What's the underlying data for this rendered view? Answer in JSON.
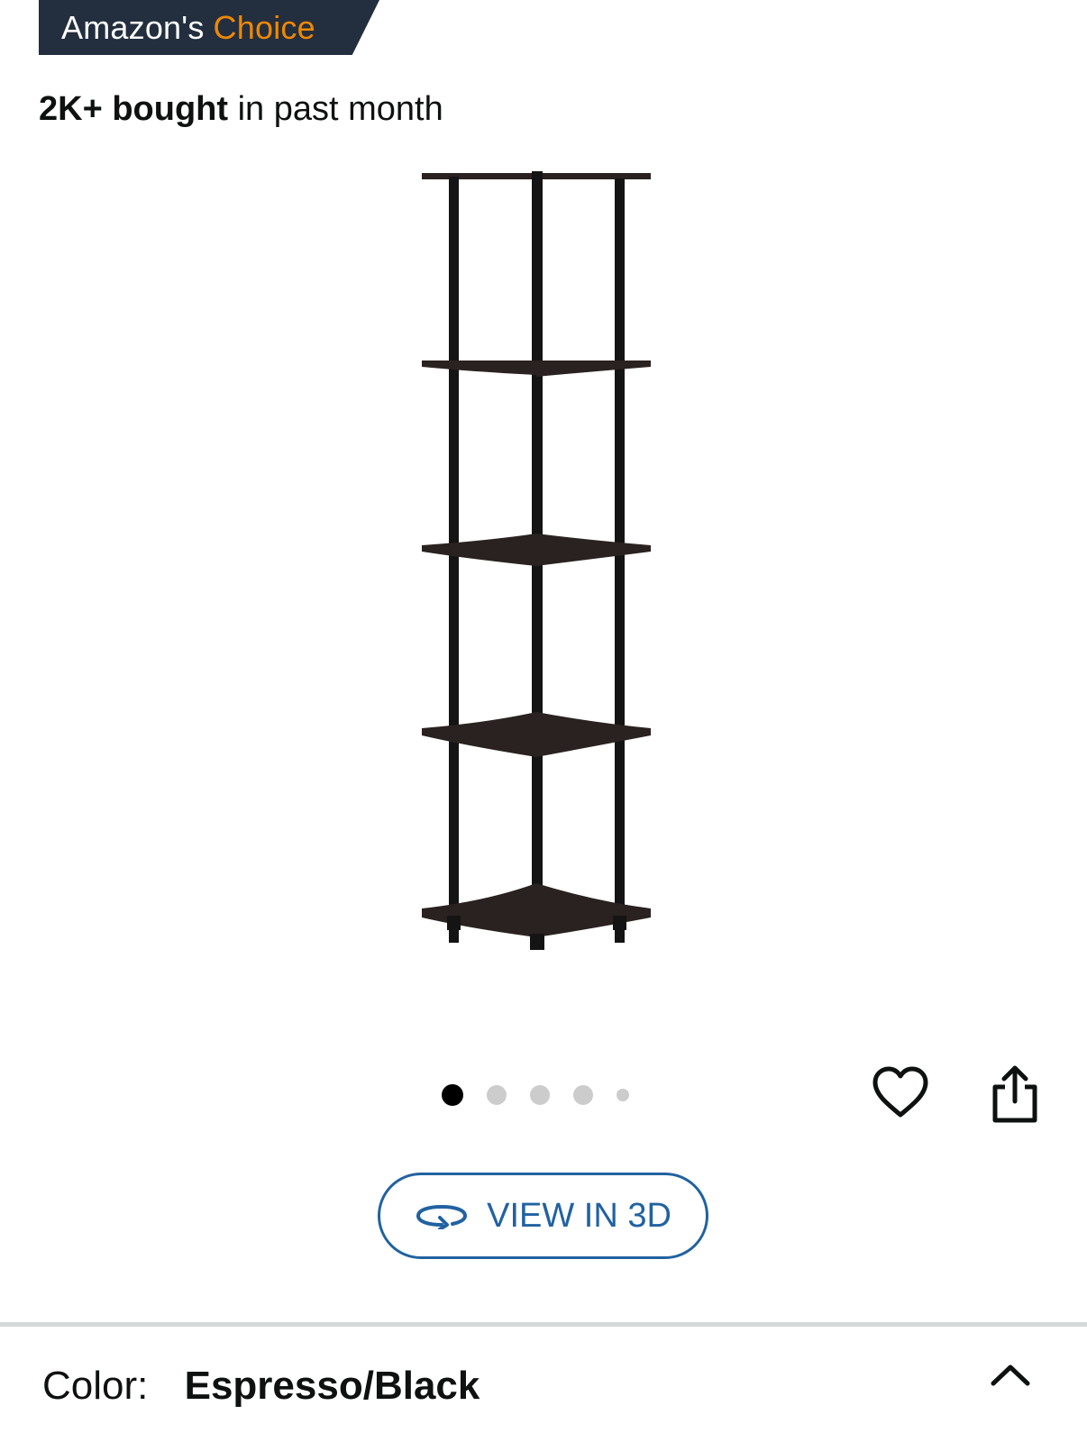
{
  "badge": {
    "prefix": "Amazon's",
    "highlight": "Choice",
    "bg_color": "#232f3e",
    "highlight_color": "#f08804"
  },
  "social_proof": {
    "count": "2K+ bought",
    "rest": "in past month"
  },
  "product_image": {
    "icon": "corner-shelf-image"
  },
  "carousel": {
    "total": 5,
    "active_index": 0
  },
  "actions": {
    "wishlist_icon": "heart-icon",
    "share_icon": "share-icon"
  },
  "view3d": {
    "label": "VIEW IN 3D",
    "icon": "rotate-3d-icon",
    "color": "#2162a1"
  },
  "color_selector": {
    "label": "Color:",
    "value": "Espresso/Black",
    "toggle_icon": "chevron-up-icon"
  }
}
